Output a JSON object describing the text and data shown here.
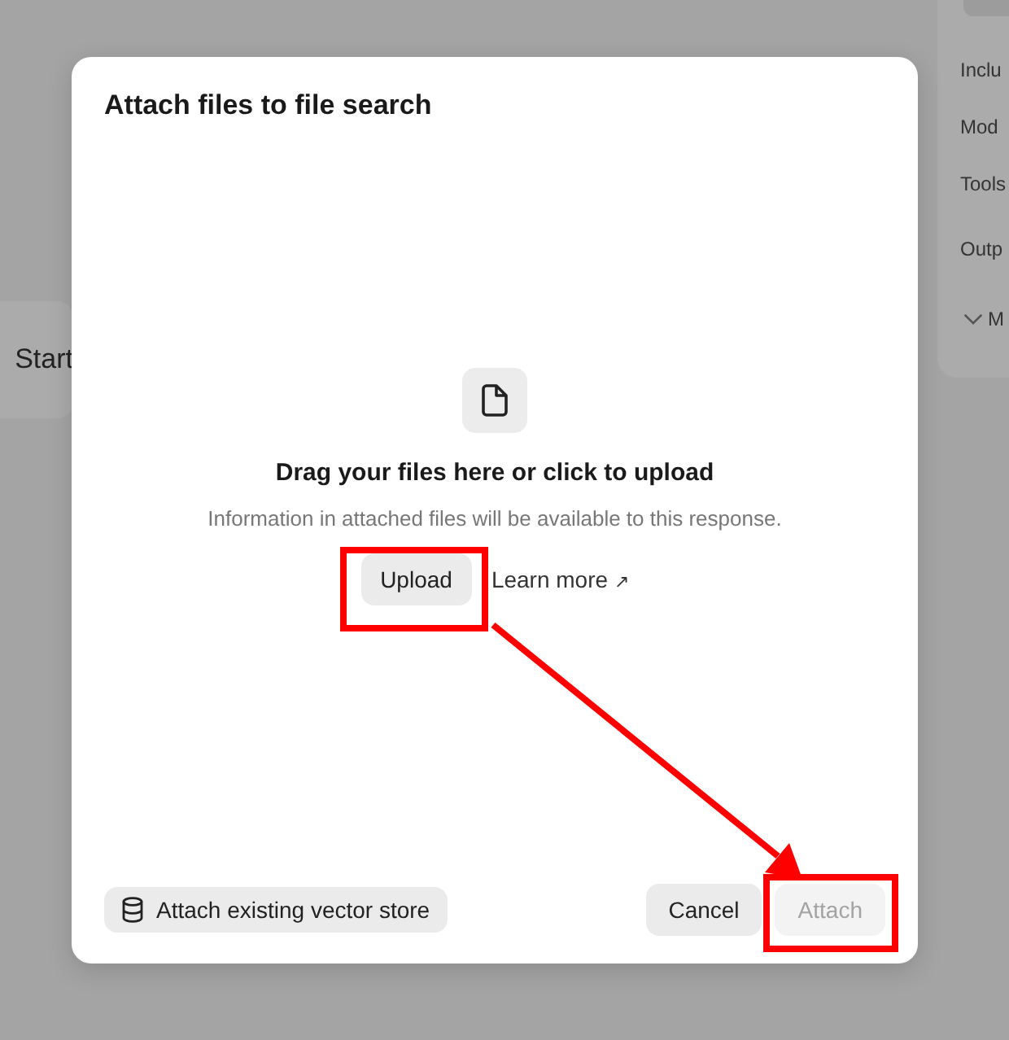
{
  "background": {
    "start_label": "Start",
    "side_items": [
      "Inclu",
      "Mod",
      "Tools",
      "Outp"
    ],
    "side_toggle": "M"
  },
  "dialog": {
    "title": "Attach files to file search",
    "drop_zone": {
      "heading": "Drag your files here or click to upload",
      "description": "Information in attached files will be available to this response.",
      "upload_button": "Upload",
      "learn_more": "Learn more",
      "learn_more_icon": "↗"
    },
    "vector_store_button": "Attach existing vector store",
    "buttons": [
      {
        "label": "Cancel",
        "disabled": false
      },
      {
        "label": "Attach",
        "disabled": true
      }
    ]
  }
}
